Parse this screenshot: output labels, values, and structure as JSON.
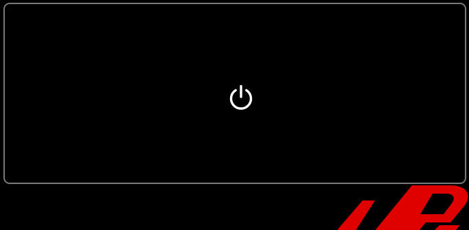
{
  "panel": {
    "border_color": "#7a7a7a",
    "background": "#000000"
  },
  "power_button": {
    "icon": "power-icon",
    "color": "#ffffff"
  },
  "watermark": {
    "color": "#e10000"
  }
}
